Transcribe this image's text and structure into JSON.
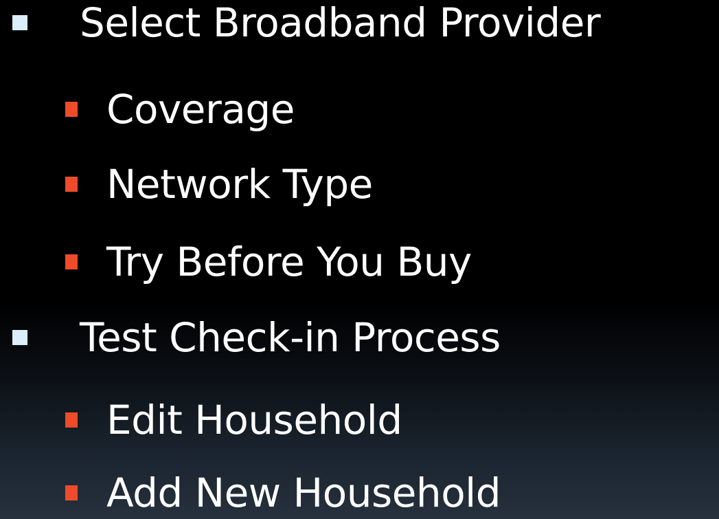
{
  "slide": {
    "items": [
      {
        "level": 1,
        "label": "Select Broadband Provider"
      },
      {
        "level": 2,
        "label": "Coverage"
      },
      {
        "level": 2,
        "label": "Network Type"
      },
      {
        "level": 2,
        "label": "Try Before You Buy"
      },
      {
        "level": 1,
        "label": "Test Check-in Process"
      },
      {
        "level": 2,
        "label": "Edit Household"
      },
      {
        "level": 2,
        "label": "Add New Household"
      }
    ]
  },
  "colors": {
    "background": "#000000",
    "text": "#ffffff",
    "level1_bullet": "#dbeefc",
    "level2_bullet": "#ee4b2b"
  }
}
